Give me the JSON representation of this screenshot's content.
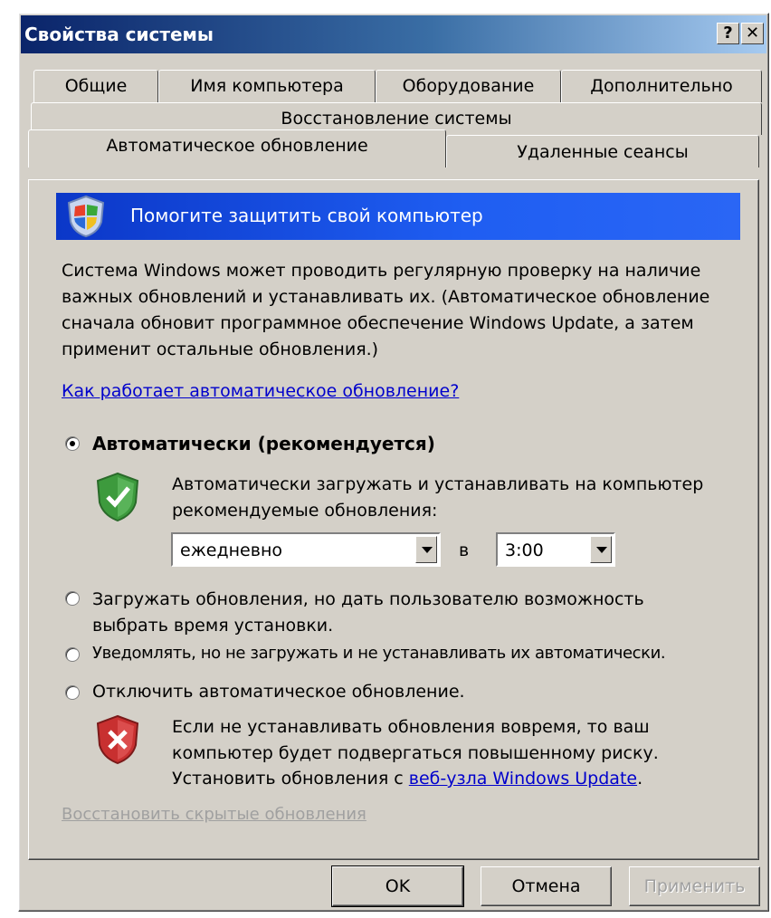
{
  "window": {
    "title": "Свойства системы",
    "help_glyph": "?",
    "close_glyph": "✕"
  },
  "tabs": {
    "row1": [
      "Общие",
      "Имя компьютера",
      "Оборудование",
      "Дополнительно"
    ],
    "row2": [
      "Восстановление системы"
    ],
    "row3": [
      "Автоматическое обновление",
      "Удаленные сеансы"
    ],
    "active": "Автоматическое обновление"
  },
  "banner": {
    "text": "Помогите защитить свой компьютер",
    "icon": "windows-security-shield-icon"
  },
  "description": "Система Windows может проводить регулярную проверку на наличие важных обновлений и устанавливать их. (Автоматическое обновление сначала обновит программное обеспечение Windows Update, а затем применит остальные обновления.)",
  "how_link": "Как работает автоматическое обновление?",
  "options": {
    "auto": {
      "label": "Автоматически (рекомендуется)",
      "checked": true,
      "detail": "Автоматически загружать и устанавливать на компьютер рекомендуемые обновления:",
      "icon": "green-check-shield-icon",
      "frequency": "ежедневно",
      "at_label": "в",
      "time": "3:00"
    },
    "download": {
      "label": "Загружать обновления, но дать пользователю возможность выбрать время установки.",
      "checked": false
    },
    "notify": {
      "label": "Уведомлять, но не загружать и не устанавливать их автоматически.",
      "checked": false
    },
    "off": {
      "label": "Отключить автоматическое обновление.",
      "checked": false,
      "icon": "red-x-shield-icon",
      "warning": "Если не устанавливать обновления вовремя, то ваш компьютер будет подвергаться повышенному риску.",
      "install_prefix": "Установить обновления с ",
      "install_link": "веб-узла Windows Update",
      "install_suffix": "."
    }
  },
  "restore_hidden": "Восстановить скрытые обновления",
  "buttons": {
    "ok": "OK",
    "cancel": "Отмена",
    "apply": "Применить"
  },
  "colors": {
    "titlebar": "#0a246a",
    "banner": "#1f5ef2",
    "dialog": "#d4d0c8",
    "link": "#0000cc"
  }
}
